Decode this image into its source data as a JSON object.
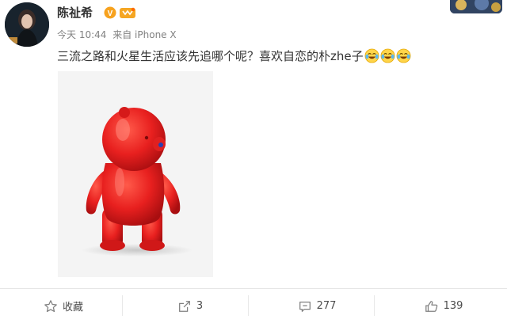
{
  "post": {
    "username": "陈祉希",
    "time": "今天 10:44",
    "source": "来自 iPhone X",
    "text": "三流之路和火星生活应该先追哪个呢？喜欢自恋的朴zhe子",
    "emoji_name": "laugh-cry-emoji",
    "verified_badge": "V"
  },
  "actions": {
    "favorite_label": "收藏",
    "repost_count": "3",
    "comment_count": "277",
    "like_count": "139"
  },
  "colors": {
    "badge_orange": "#f7a21e",
    "bear_red": "#e8201f",
    "text_main": "#333333",
    "text_meta": "#808080"
  }
}
